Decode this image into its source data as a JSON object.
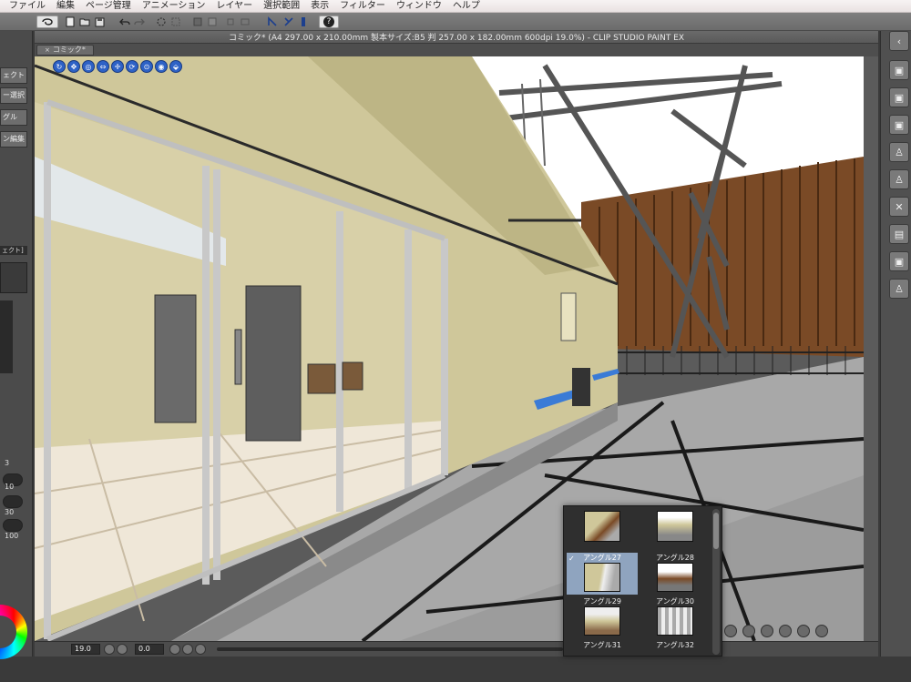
{
  "menubar": {
    "items": [
      "ファイル",
      "編集",
      "ページ管理",
      "アニメーション",
      "レイヤー",
      "選択範囲",
      "表示",
      "フィルター",
      "ウィンドウ",
      "ヘルプ"
    ]
  },
  "toolbar": {
    "buttons": [
      "clip-studio-icon",
      "new-icon",
      "open-icon",
      "save-icon",
      "undo-icon",
      "redo-icon",
      "clear-icon",
      "transform-icon",
      "snap-ruler-icon",
      "snap-special-icon",
      "snap-grid-icon",
      "help-icon"
    ],
    "help_glyph": "?"
  },
  "document": {
    "title": "コミック* (A4 297.00 x 210.00mm 製本サイズ:B5 判 257.00 x 182.00mm 600dpi 19.0%) - CLIP STUDIO PAINT EX",
    "tab_label": "コミック*"
  },
  "left_panel": {
    "buttons": [
      "ェクト",
      "ー選択",
      "グル",
      "ン編集"
    ],
    "sub_label": "ェクト]",
    "numbers": [
      "3",
      "10",
      "30",
      "100"
    ]
  },
  "statusbar": {
    "zoom": "19.0",
    "rotation": "0.0"
  },
  "angle_popup": {
    "items": [
      {
        "label": "",
        "selected": false
      },
      {
        "label": "",
        "selected": false
      },
      {
        "label": "アングル27",
        "selected": true
      },
      {
        "label": "アングル28",
        "selected": false
      },
      {
        "label": "アングル29",
        "selected": false
      },
      {
        "label": "アングル30",
        "selected": false
      },
      {
        "label": "アングル31",
        "selected": false
      },
      {
        "label": "アングル32",
        "selected": false
      }
    ],
    "check_glyph": "✓"
  },
  "colors": {
    "wall": "#cfc79a",
    "floor": "#a9a9a9",
    "fence": "#7a4a26",
    "sky": "#ffffff",
    "gizmo": "#2e62c6",
    "selection": "#8fa4bf"
  }
}
